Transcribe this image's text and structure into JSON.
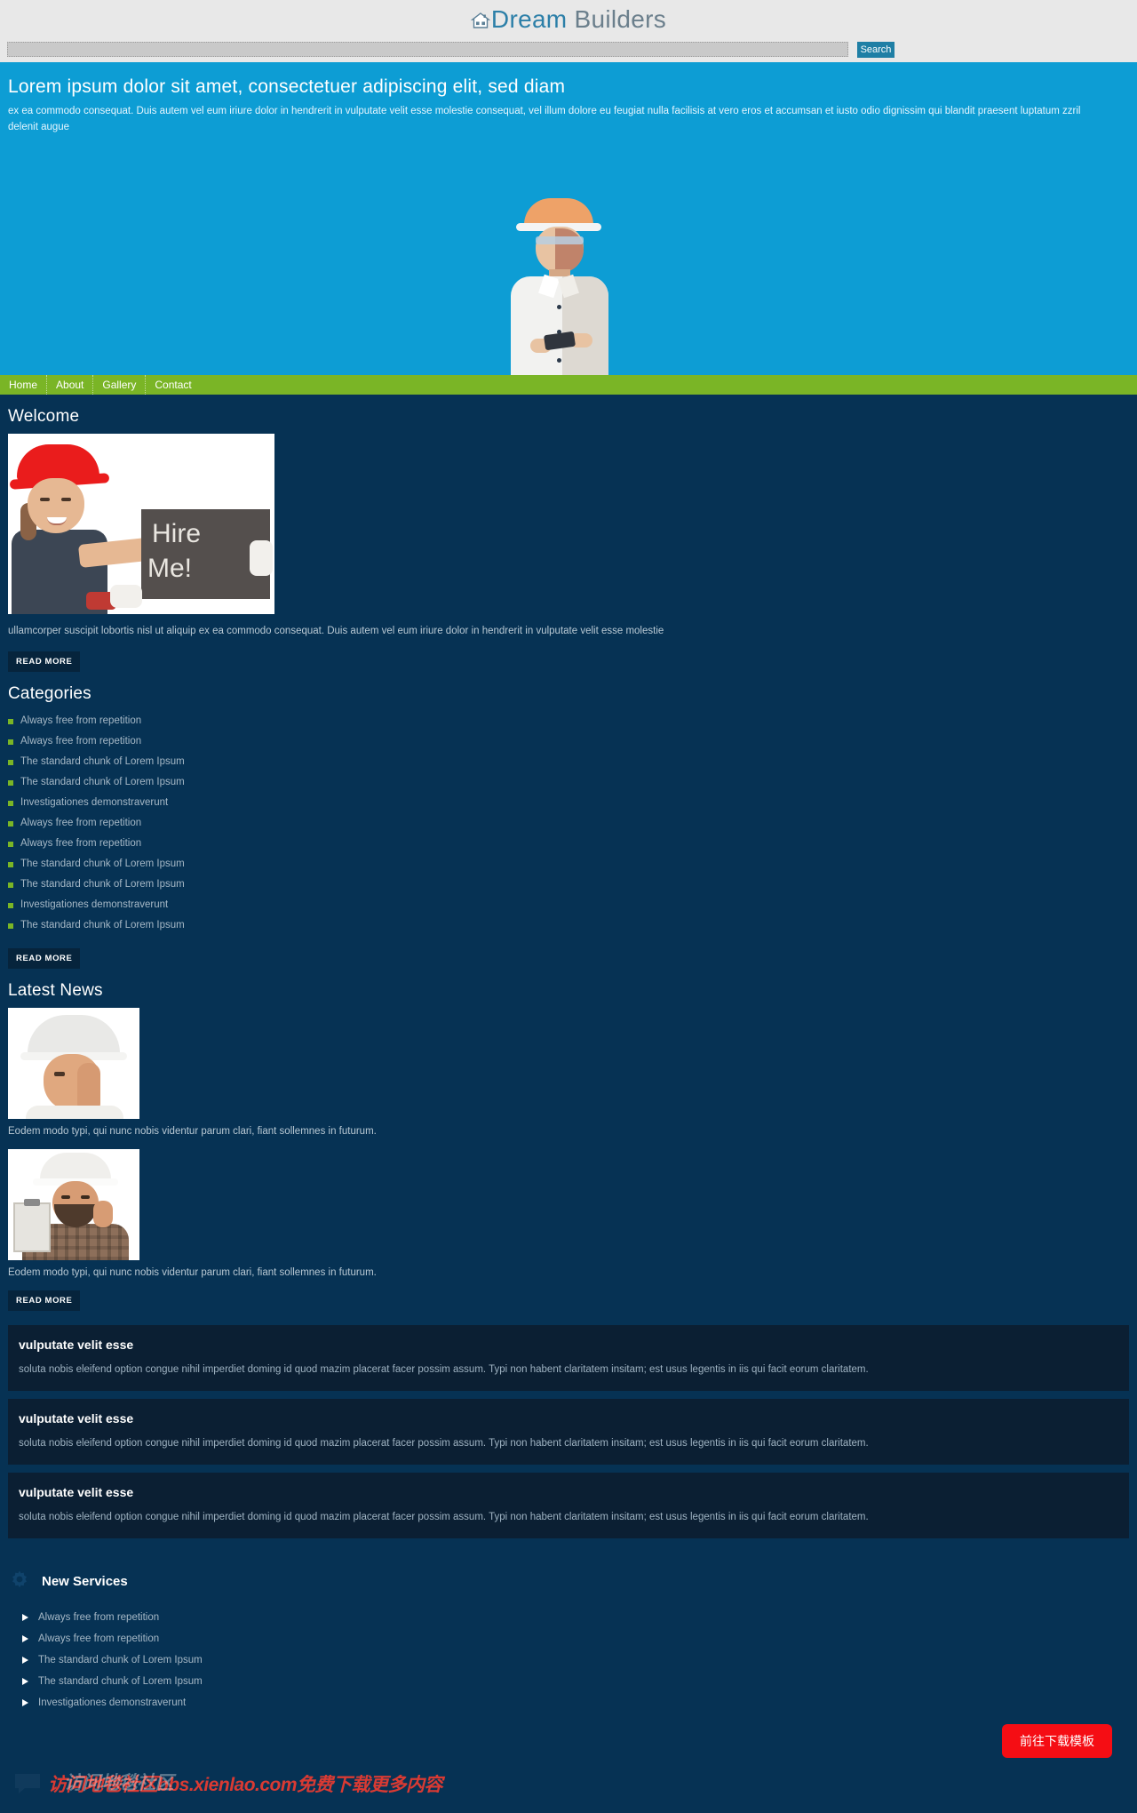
{
  "header": {
    "brand_icon": "house-icon",
    "brand_strong": "Dream",
    "brand_light": " Builders"
  },
  "search": {
    "value": "",
    "placeholder": "",
    "button_label": "Search"
  },
  "hero": {
    "title": "Lorem ipsum dolor sit amet, consectetuer adipiscing elit, sed diam",
    "description": "ex ea commodo consequat. Duis autem vel eum iriure dolor in hendrerit in vulputate velit esse molestie consequat, vel illum dolore eu feugiat nulla facilisis at vero eros et accumsan et iusto odio dignissim qui blandit praesent luptatum zzril delenit augue",
    "image_alt": "engineer-with-helmet-photo"
  },
  "nav": {
    "items": [
      {
        "label": "Home"
      },
      {
        "label": "About"
      },
      {
        "label": "Gallery"
      },
      {
        "label": "Contact"
      }
    ]
  },
  "welcome": {
    "heading": "Welcome",
    "image_alt": "hire-me-sign-photo",
    "sign_line1": "Hire",
    "sign_line2": "Me!",
    "text": "ullamcorper suscipit lobortis nisl ut aliquip ex ea commodo consequat. Duis autem vel eum iriure dolor in hendrerit in vulputate velit esse molestie",
    "read_more": "READ MORE"
  },
  "categories": {
    "heading": "Categories",
    "items": [
      {
        "label": "Always free from repetition"
      },
      {
        "label": "Always free from repetition"
      },
      {
        "label": "The standard chunk of Lorem Ipsum"
      },
      {
        "label": "The standard chunk of Lorem Ipsum"
      },
      {
        "label": "Investigationes demonstraverunt"
      },
      {
        "label": "Always free from repetition"
      },
      {
        "label": "Always free from repetition"
      },
      {
        "label": "The standard chunk of Lorem Ipsum"
      },
      {
        "label": "The standard chunk of Lorem Ipsum"
      },
      {
        "label": "Investigationes demonstraverunt"
      },
      {
        "label": "The standard chunk of Lorem Ipsum"
      }
    ],
    "read_more": "READ MORE"
  },
  "latest_news": {
    "heading": "Latest News",
    "items": [
      {
        "image_alt": "worker-white-helmet-photo",
        "caption": "Eodem modo typi, qui nunc nobis videntur parum clari, fiant sollemnes in futurum."
      },
      {
        "image_alt": "worker-with-clipboard-photo",
        "caption": "Eodem modo typi, qui nunc nobis videntur parum clari, fiant sollemnes in futurum."
      }
    ],
    "read_more": "READ MORE"
  },
  "panels": [
    {
      "title": "vulputate velit esse",
      "text": "soluta nobis eleifend option congue nihil imperdiet doming id quod mazim placerat facer possim assum. Typi non habent claritatem insitam; est usus legentis in iis qui facit eorum claritatem."
    },
    {
      "title": "vulputate velit esse",
      "text": "soluta nobis eleifend option congue nihil imperdiet doming id quod mazim placerat facer possim assum. Typi non habent claritatem insitam; est usus legentis in iis qui facit eorum claritatem."
    },
    {
      "title": "vulputate velit esse",
      "text": "soluta nobis eleifend option congue nihil imperdiet doming id quod mazim placerat facer possim assum. Typi non habent claritatem insitam; est usus legentis in iis qui facit eorum claritatem."
    }
  ],
  "services": {
    "icon": "gear-icon",
    "heading": "New Services",
    "items": [
      {
        "label": "Always free from repetition"
      },
      {
        "label": "Always free from repetition"
      },
      {
        "label": "The standard chunk of Lorem Ipsum"
      },
      {
        "label": "The standard chunk of Lorem Ipsum"
      },
      {
        "label": "Investigationes demonstraverunt"
      }
    ]
  },
  "overlay": {
    "download_button": "前往下载模板",
    "watermark_text": "访问地毯社区bbs.xienlao.com免费下载更多内容",
    "watermark_ghost": "访问地毯社区",
    "watermark_icon": "speech-bubble-icon"
  },
  "colors": {
    "page_bg": "#063254",
    "hero_bg": "#0d9dd4",
    "nav_bg": "#7ab526",
    "accent_green": "#7ab526",
    "panel_bg": "#0b1f33",
    "brand_blue": "#2c7fa8",
    "download_red": "#f50d14"
  }
}
